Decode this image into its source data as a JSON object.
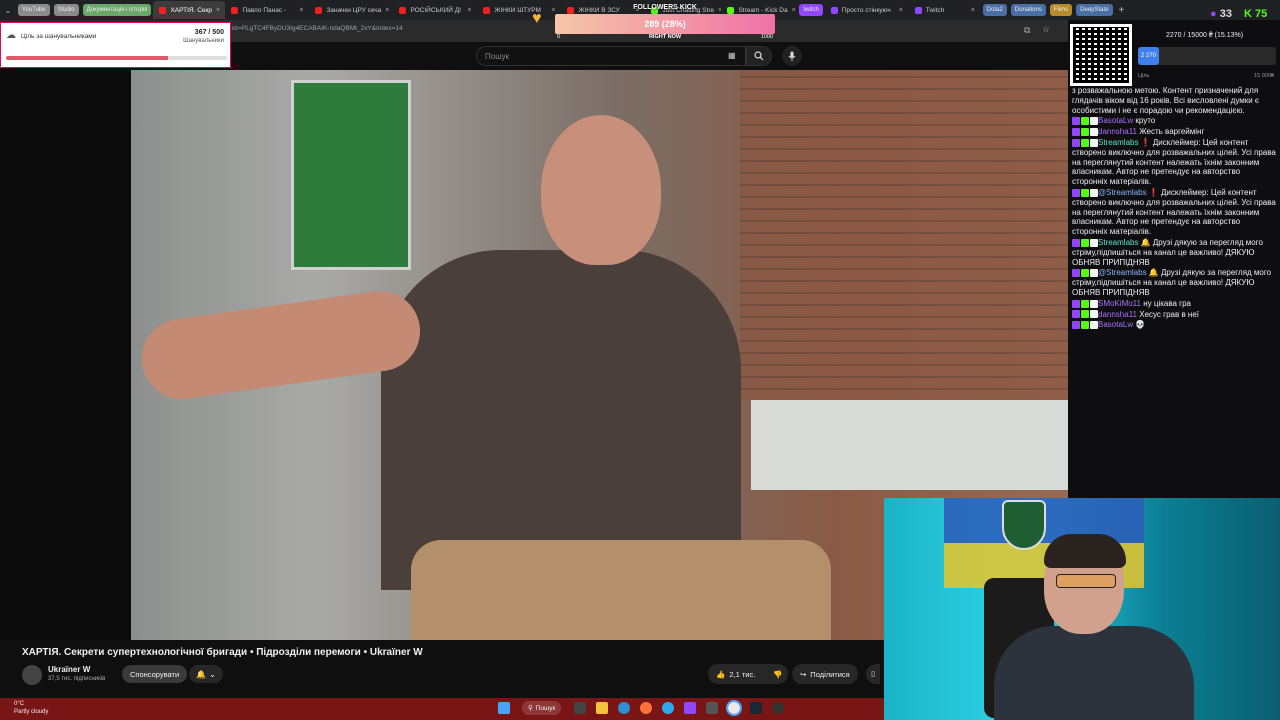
{
  "browser": {
    "tabs": [
      {
        "label": "YouTube",
        "kind": "chip",
        "color": "#8b8b8b"
      },
      {
        "label": "Studio",
        "kind": "chip",
        "color": "#8b8b8b"
      },
      {
        "label": "Документація і історія",
        "kind": "chip",
        "color": "#6aa86a"
      },
      {
        "label": "ХАРТІЯ. Секр",
        "kind": "tab",
        "active": true
      },
      {
        "label": "Павло Панас -"
      },
      {
        "label": "Заначки ЦРУ сеча"
      },
      {
        "label": "РОСІЙСЬКИЙ ДІ"
      },
      {
        "label": "ЖІНКИ ШТУРМ"
      },
      {
        "label": "ЖІНКИ В ЗСУ"
      },
      {
        "label": "Just Chatting Stre"
      },
      {
        "label": "Stream - Kick Da"
      },
      {
        "label": "twitch",
        "kind": "chip",
        "color": "#9146ff"
      },
      {
        "label": "Просто стінкуюч"
      },
      {
        "label": "Twitch"
      },
      {
        "label": "Dota2",
        "kind": "chip",
        "color": "#4a6fa5"
      },
      {
        "label": "Donations",
        "kind": "chip",
        "color": "#4a6fa5"
      },
      {
        "label": "Films",
        "kind": "chip",
        "color": "#b98a2a"
      },
      {
        "label": "DeepState",
        "kind": "chip",
        "color": "#4a6fa5"
      }
    ],
    "url": "list=PLgTC4FByDU3Ig4ECABAIK-ndaQBMt_2xY&index=14"
  },
  "goal_widget": {
    "label": "Ціль за шанувальниками",
    "count": "367 / 500",
    "sub": "Шанувальники",
    "progress": 0.734
  },
  "followers_bar": {
    "title": "FOLLOWERS KICK",
    "value": "289 (28%)",
    "min": "0",
    "mid": "RIGHT NOW",
    "max": "1000",
    "progress": 0.289
  },
  "youtube": {
    "search_placeholder": "Пошук",
    "video_title": "ХАРТІЯ. Секрети супертехнологічної бригади • Підрозділи перемоги • Ukraїner W",
    "channel_name": "Ukraїner W",
    "subscribers": "37,5 тис. підписників",
    "sponsor_label": "Спонсорувати",
    "likes": "2,1 тис.",
    "share_label": "Поділитися"
  },
  "donation": {
    "summary": "2270 / 15000 ₴ (15.13%)",
    "fill_label": "2 270",
    "min_label": "Ціль",
    "max_label": "15 000₴",
    "progress": 0.1513
  },
  "counters": {
    "viewers": "33",
    "kick": "75"
  },
  "chat": [
    {
      "user": "",
      "text": "з розважальною метою. Контент призначений для глядачів віком від 16 років. Всі висловлені думки є особистими і не є порадою чи рекомендацією.",
      "color": "#efeff1"
    },
    {
      "user": "BasotaLw",
      "text": "круто",
      "color": "#a970ff"
    },
    {
      "user": "dannsha11",
      "text": "Жесть варгеймінг",
      "color": "#a970ff"
    },
    {
      "user": "Streamlabs",
      "text": "❗ Дисклеймер: Цей контент створено виключно для розважальних цілей. Усі права на переглянутий контент належать їхнім законним власникам. Автор не претендує на авторство сторонніх матеріалів.",
      "color": "#5ae0c8"
    },
    {
      "user": "@Streamlabs",
      "text": "❗ Дисклеймер: Цей контент створено виключно для розважальних цілей. Усі права на переглянутий контент належать їхнім законним власникам. Автор не претендує на авторство сторонніх матеріалів.",
      "color": "#8ab4f8"
    },
    {
      "user": "Streamlabs",
      "text": "🔔 Друзі дякую за перегляд мого стріму,підпишіться на канал це важливо! ДЯКУЮ ОБНЯВ ПРИПІДНЯВ",
      "color": "#5ae0c8"
    },
    {
      "user": "@Streamlabs",
      "text": "🔔 Друзі дякую за перегляд мого стріму,підпишіться на канал це важливо! ДЯКУЮ ОБНЯВ ПРИПІДНЯВ",
      "color": "#8ab4f8"
    },
    {
      "user": "SMoKiMo11",
      "text": "ну цікава гра",
      "color": "#a970ff"
    },
    {
      "user": "dannsha11",
      "text": "Хесус грав в неї",
      "color": "#a970ff"
    },
    {
      "user": "BasotaLw",
      "text": "💀",
      "color": "#a970ff"
    }
  ],
  "taskbar": {
    "weather_temp": "0°C",
    "weather_desc": "Partly cloudy",
    "search_label": "Пошук"
  },
  "colors": {
    "youtube_red": "#ff0000",
    "taskbar": "#7a1515",
    "goal_fill": "#e05b6a",
    "donation_fill": "#3f7ff2"
  }
}
